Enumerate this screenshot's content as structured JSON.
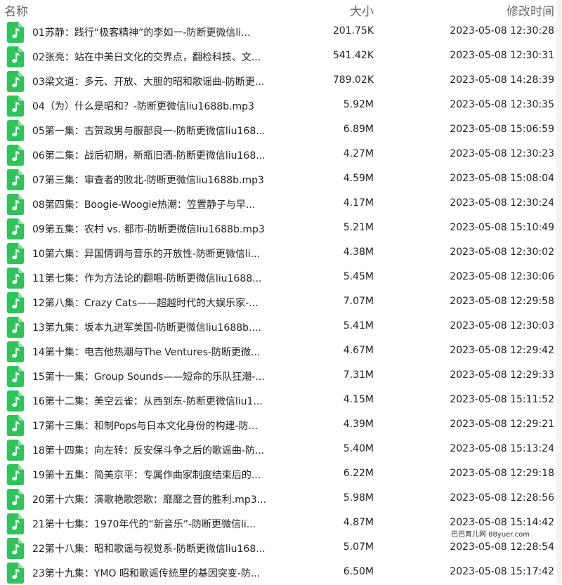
{
  "header": {
    "name": "名称",
    "size": "大小",
    "modified": "修改时间"
  },
  "icon": "music-file-icon",
  "accent": "#2fc35a",
  "files": [
    {
      "name": "01苏静：践行“极客精神”的李如一-防断更微信li...",
      "size": "201.75K",
      "modified": "2023-05-08 12:30:28"
    },
    {
      "name": "02张亮：站在中美日文化的交界点，翻检科技、文...",
      "size": "541.42K",
      "modified": "2023-05-08 12:30:31"
    },
    {
      "name": "03梁文道：多元、开放、大胆的昭和歌谣曲-防断更...",
      "size": "789.02K",
      "modified": "2023-05-08 14:28:39"
    },
    {
      "name": "04（为）什么是昭和？-防断更微信liu1688b.mp3",
      "size": "5.92M",
      "modified": "2023-05-08 12:30:35"
    },
    {
      "name": "05第一集：古贺政男与服部良一-防断更微信liu168...",
      "size": "6.89M",
      "modified": "2023-05-08 15:06:59"
    },
    {
      "name": "06第二集：战后初期，新瓶旧酒-防断更微信liu168...",
      "size": "4.27M",
      "modified": "2023-05-08 12:30:23"
    },
    {
      "name": "07第三集：审查者的败北-防断更微信liu1688b.mp3",
      "size": "4.59M",
      "modified": "2023-05-08 15:08:04"
    },
    {
      "name": "08第四集：Boogie-Woogie热潮：笠置静子与早...",
      "size": "4.17M",
      "modified": "2023-05-08 12:30:24"
    },
    {
      "name": "09第五集：农村 vs. 都市-防断更微信liu1688b.mp3",
      "size": "5.21M",
      "modified": "2023-05-08 15:10:49"
    },
    {
      "name": "10第六集：异国情调与音乐的开放性-防断更微信li...",
      "size": "4.38M",
      "modified": "2023-05-08 12:30:02"
    },
    {
      "name": "11第七集：作为方法论的翻唱-防断更微信liu1688...",
      "size": "5.45M",
      "modified": "2023-05-08 12:30:06"
    },
    {
      "name": "12第八集：Crazy Cats——超越时代的大娱乐家-...",
      "size": "7.07M",
      "modified": "2023-05-08 12:29:58"
    },
    {
      "name": "13第九集：坂本九进军美国-防断更微信liu1688b....",
      "size": "5.41M",
      "modified": "2023-05-08 12:30:03"
    },
    {
      "name": "14第十集：电吉他热潮与The Ventures-防断更微...",
      "size": "4.67M",
      "modified": "2023-05-08 12:29:42"
    },
    {
      "name": "15第十一集：Group Sounds——短命的乐队狂潮-...",
      "size": "7.31M",
      "modified": "2023-05-08 12:29:33"
    },
    {
      "name": "16第十二集：美空云雀：从西到东-防断更微信liu1...",
      "size": "4.15M",
      "modified": "2023-05-08 15:11:52"
    },
    {
      "name": "17第十三集：和制Pops与日本文化身份的构建-防...",
      "size": "4.39M",
      "modified": "2023-05-08 12:29:21"
    },
    {
      "name": "18第十四集：向左转：反安保斗争之后的歌谣曲-防...",
      "size": "5.40M",
      "modified": "2023-05-08 15:13:24"
    },
    {
      "name": "19第十五集：简美京平：专属作曲家制度结束后的...",
      "size": "6.22M",
      "modified": "2023-05-08 12:29:18"
    },
    {
      "name": "20第十六集：演歌艳歌怨歌：靡靡之音的胜利.mp3...",
      "size": "5.98M",
      "modified": "2023-05-08 12:28:56"
    },
    {
      "name": "21第十七集：1970年代的“新音乐”-防断更微信li...",
      "size": "4.87M",
      "modified": "2023-05-08 15:14:42"
    },
    {
      "name": "22第十八集：昭和歌谣与视觉系-防断更微信liu168...",
      "size": "5.07M",
      "modified": "2023-05-08 12:28:54"
    },
    {
      "name": "23第十九集：YMO 昭和歌谣传统里的基因突变-防...",
      "size": "6.50M",
      "modified": "2023-05-08 15:17:42"
    }
  ],
  "watermark": "巴巴育儿网 88yuer.com"
}
